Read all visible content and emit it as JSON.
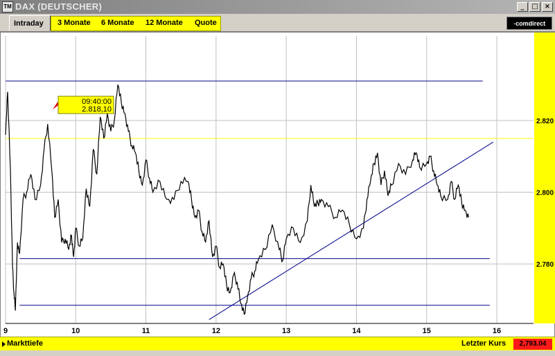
{
  "window": {
    "title": "DAX (DEUTSCHER)",
    "app_icon": "TM",
    "btn_min": "_",
    "btn_max": "□",
    "btn_close": "×"
  },
  "tabs": [
    {
      "label": "Intraday",
      "active": true
    },
    {
      "label": "3 Monate"
    },
    {
      "label": "6 Monate"
    },
    {
      "label": "12 Monate"
    },
    {
      "label": "Quote"
    }
  ],
  "logo": "◦comdirect",
  "tooltip": {
    "time": "09:40:00",
    "value": "2.818,10"
  },
  "status": {
    "left_label": "Markttiefe",
    "last_label": "Letzter Kurs",
    "last_value": "2,793.04"
  },
  "colors": {
    "price": "#000000",
    "lines": "#00008b",
    "fib": "#ffff00",
    "grid": "#c0c0c0",
    "accent": "#ffff00",
    "last_bg": "#ff1a1a"
  },
  "chart_data": {
    "type": "line",
    "x_ticks": [
      "9",
      "10",
      "11",
      "12",
      "13",
      "14",
      "15",
      "16"
    ],
    "y_ticks": [
      "2.820",
      "2.800",
      "2.780"
    ],
    "ylim": [
      2764,
      2842
    ],
    "xlim": [
      9,
      16
    ],
    "series": [
      {
        "x": [
          9.0,
          9.03,
          9.07,
          9.1,
          9.12,
          9.14,
          9.17,
          9.2,
          9.25,
          9.3,
          9.36,
          9.42,
          9.5,
          9.55,
          9.6,
          9.66,
          9.7,
          9.75,
          9.8,
          9.85,
          9.9,
          9.94,
          9.97,
          10.0,
          10.05,
          10.1,
          10.15,
          10.2,
          10.25,
          10.3,
          10.35,
          10.4,
          10.45,
          10.5,
          10.55,
          10.6,
          10.65,
          10.7,
          10.75,
          10.8,
          10.85,
          10.9,
          10.95,
          11.0,
          11.05,
          11.1,
          11.2,
          11.3,
          11.4,
          11.5,
          11.6,
          11.65,
          11.7,
          11.75,
          11.8,
          11.85,
          11.9,
          11.95,
          12.0,
          12.05,
          12.1,
          12.15,
          12.2,
          12.25,
          12.3,
          12.35,
          12.4,
          12.45,
          12.5,
          12.55,
          12.6,
          12.7,
          12.8,
          12.9,
          12.95,
          13.0,
          13.1,
          13.2,
          13.3,
          13.35,
          13.4,
          13.45,
          13.5,
          13.6,
          13.7,
          13.8,
          13.9,
          14.0,
          14.1,
          14.15,
          14.2,
          14.25,
          14.3,
          14.35,
          14.4,
          14.45,
          14.5,
          14.6,
          14.7,
          14.8,
          14.85,
          14.9,
          15.0,
          15.05,
          15.1,
          15.15,
          15.2,
          15.3,
          15.35,
          15.4,
          15.45,
          15.5,
          15.55,
          15.6
        ],
        "y": [
          2816,
          2828,
          2806,
          2779,
          2772,
          2767,
          2786,
          2783,
          2798,
          2800,
          2805,
          2798,
          2802,
          2812,
          2819,
          2806,
          2793,
          2798,
          2786,
          2787,
          2784,
          2788,
          2782,
          2790,
          2785,
          2787,
          2801,
          2796,
          2812,
          2805,
          2821,
          2815,
          2822,
          2817,
          2820,
          2830,
          2825,
          2822,
          2817,
          2813,
          2811,
          2806,
          2802,
          2809,
          2804,
          2800,
          2803,
          2798,
          2798,
          2803,
          2803,
          2798,
          2793,
          2795,
          2789,
          2786,
          2792,
          2782,
          2785,
          2779,
          2780,
          2774,
          2772,
          2777,
          2775,
          2769,
          2766,
          2771,
          2776,
          2778,
          2781,
          2784,
          2791,
          2784,
          2781,
          2787,
          2790,
          2786,
          2792,
          2802,
          2796,
          2797,
          2798,
          2796,
          2793,
          2795,
          2791,
          2787,
          2790,
          2798,
          2803,
          2808,
          2811,
          2802,
          2806,
          2799,
          2802,
          2808,
          2805,
          2809,
          2811,
          2807,
          2808,
          2810,
          2806,
          2802,
          2799,
          2798,
          2803,
          2798,
          2802,
          2797,
          2795,
          2793
        ]
      }
    ]
  }
}
